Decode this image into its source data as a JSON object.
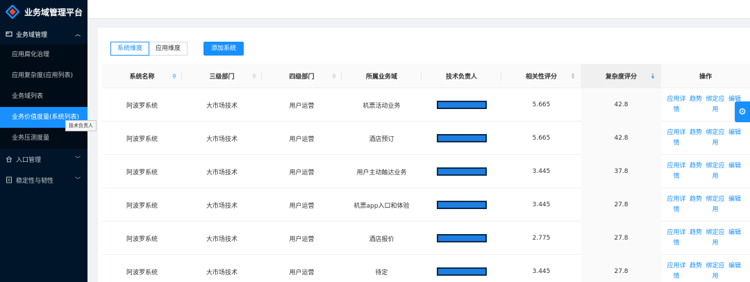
{
  "app": {
    "title": "业务域管理平台"
  },
  "sidebar": {
    "groups": [
      {
        "label": "业务域管理",
        "icon": "folder-icon",
        "expanded": true
      },
      {
        "label": "入口管理",
        "icon": "home-icon",
        "expanded": false
      },
      {
        "label": "稳定性与韧性",
        "icon": "shield-icon",
        "expanded": false
      }
    ],
    "items": [
      {
        "label": "应用腐化治理"
      },
      {
        "label": "应用复杂度(应用列表)"
      },
      {
        "label": "业务域列表"
      },
      {
        "label": "业务价值度量(系统列表)",
        "active": true
      },
      {
        "label": "业务压测度量"
      }
    ],
    "tooltip": "技术负责人"
  },
  "toolbar": {
    "tab_system": "系统维度",
    "tab_app": "应用维度",
    "add_label": "添加系统"
  },
  "table": {
    "columns": [
      "系统名称",
      "三级部门",
      "四级部门",
      "所属业务域",
      "技术负责人",
      "相关性评分",
      "复杂度评分",
      "操作"
    ],
    "actions": [
      "应用详情",
      "趋势",
      "绑定应用",
      "编辑"
    ],
    "rows": [
      {
        "name": "阿波罗系统",
        "dept3": "大市场技术",
        "dept4": "用户运营",
        "domain": "机票活动业务",
        "relevance": "5.665",
        "complexity": "42.8"
      },
      {
        "name": "阿波罗系统",
        "dept3": "大市场技术",
        "dept4": "用户运营",
        "domain": "酒店预订",
        "relevance": "5.665",
        "complexity": "42.8"
      },
      {
        "name": "阿波罗系统",
        "dept3": "大市场技术",
        "dept4": "用户运营",
        "domain": "用户主动触达业务",
        "relevance": "3.445",
        "complexity": "37.8"
      },
      {
        "name": "阿波罗系统",
        "dept3": "大市场技术",
        "dept4": "用户运营",
        "domain": "机票app入口和体验",
        "relevance": "3.445",
        "complexity": "27.8"
      },
      {
        "name": "阿波罗系统",
        "dept3": "大市场技术",
        "dept4": "用户运营",
        "domain": "酒店报价",
        "relevance": "2.775",
        "complexity": "27.8"
      },
      {
        "name": "阿波罗系统",
        "dept3": "大市场技术",
        "dept4": "用户运营",
        "domain": "待定",
        "relevance": "3.445",
        "complexity": "27.8"
      }
    ]
  },
  "colors": {
    "primary": "#1890ff",
    "sidebar": "#001529",
    "submenu": "#000c17"
  }
}
